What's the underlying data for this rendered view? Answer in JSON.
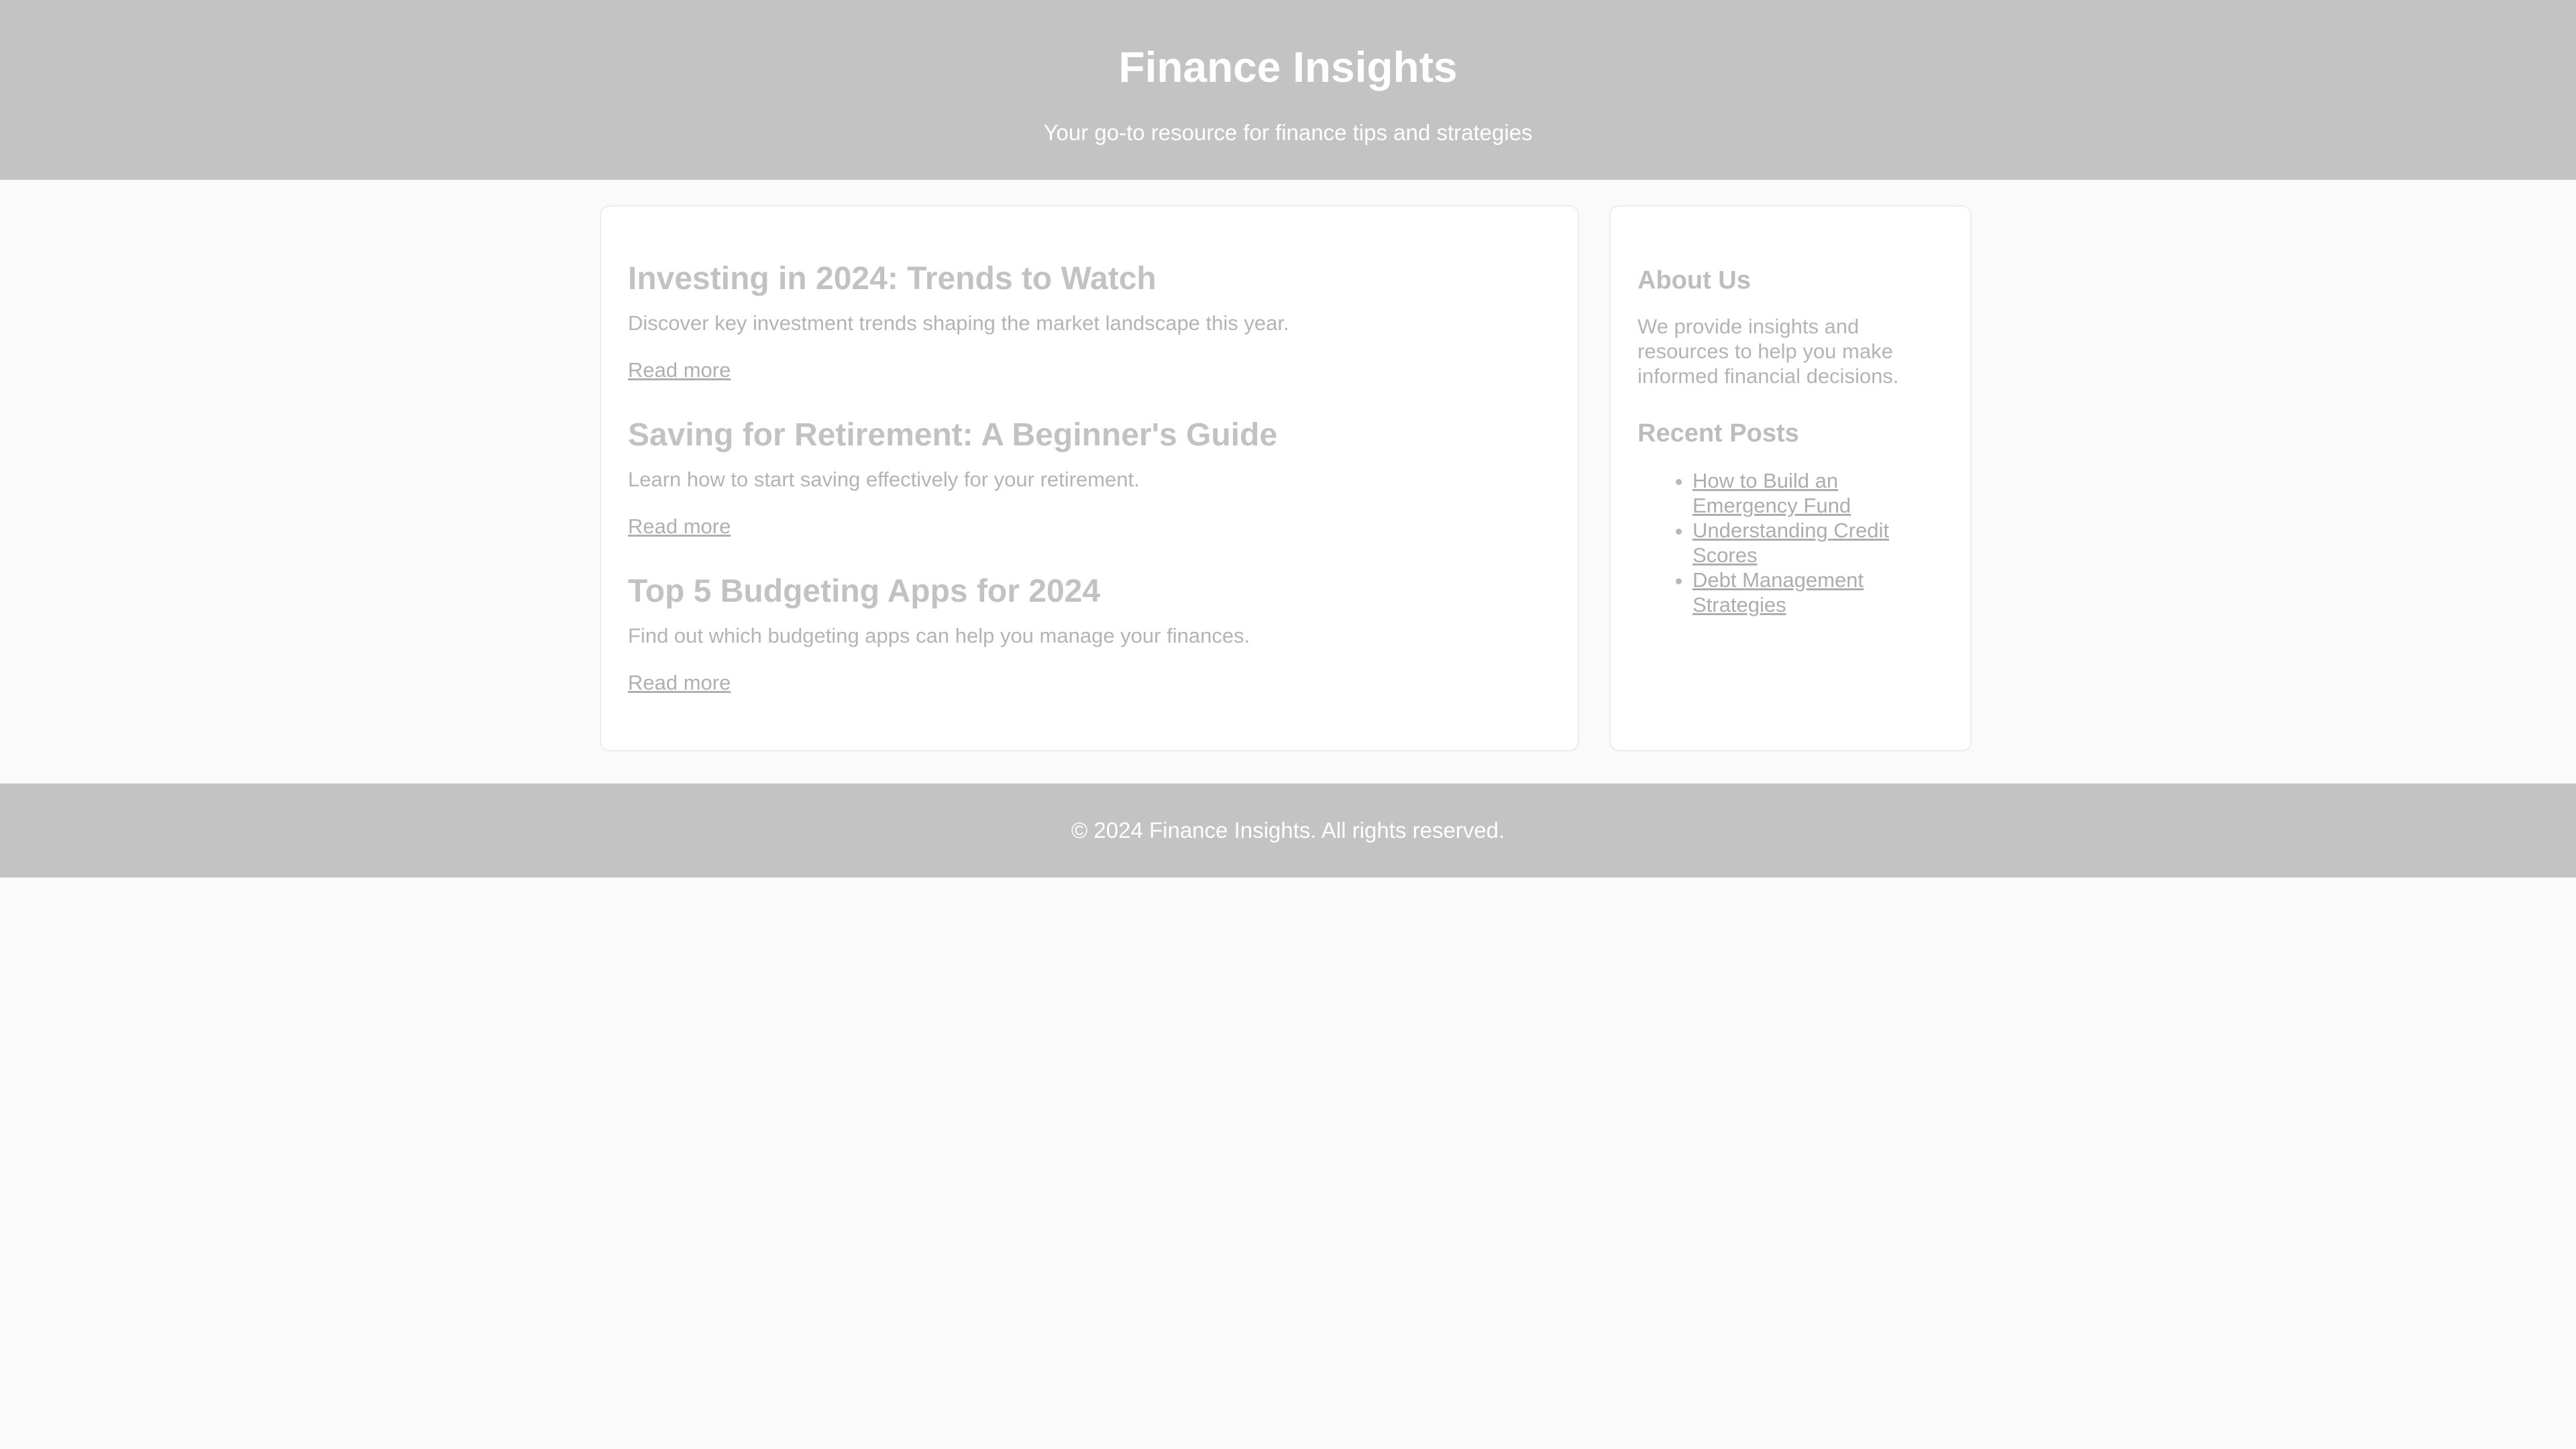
{
  "header": {
    "title": "Finance Insights",
    "subtitle": "Your go-to resource for finance tips and strategies"
  },
  "articles": [
    {
      "title": "Investing in 2024: Trends to Watch",
      "summary": "Discover key investment trends shaping the market landscape this year.",
      "link_label": "Read more"
    },
    {
      "title": "Saving for Retirement: A Beginner's Guide",
      "summary": "Learn how to start saving effectively for your retirement.",
      "link_label": "Read more"
    },
    {
      "title": "Top 5 Budgeting Apps for 2024",
      "summary": "Find out which budgeting apps can help you manage your finances.",
      "link_label": "Read more"
    }
  ],
  "sidebar": {
    "about_heading": "About Us",
    "about_text": "We provide insights and resources to help you make informed financial decisions.",
    "recent_heading": "Recent Posts",
    "recent_posts": [
      "How to Build an Emergency Fund",
      "Understanding Credit Scores",
      "Debt Management Strategies"
    ]
  },
  "footer": {
    "copyright": "© 2024 Finance Insights. All rights reserved."
  }
}
